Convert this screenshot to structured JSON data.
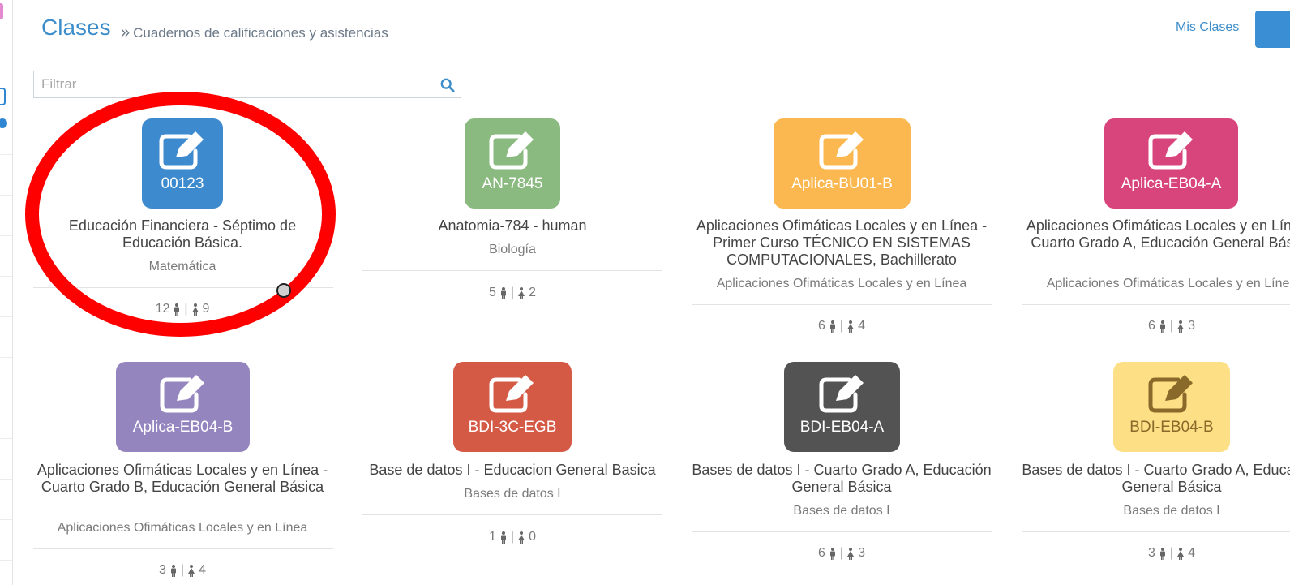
{
  "header": {
    "title": "Clases",
    "subtitle": "Cuadernos de calificaciones y asistencias",
    "separator": "»",
    "my_classes_link": "Mis Clases"
  },
  "filter": {
    "placeholder": "Filtrar"
  },
  "colors": {
    "accent": "#3c8dc9",
    "annotation": "#fe0000"
  },
  "classes": [
    {
      "code": "00123",
      "name": "Educación Financiera - Séptimo de Educación Básica.",
      "subject": "Matemática",
      "male": "12",
      "female": "9",
      "color": "#3e8ace"
    },
    {
      "code": "AN-7845",
      "name": "Anatomia-784 - human",
      "subject": "Biología",
      "male": "5",
      "female": "2",
      "color": "#8aba7f"
    },
    {
      "code": "Aplica-BU01-B",
      "name": "Aplicaciones Ofimáticas Locales y en Línea - Primer Curso TÉCNICO EN SISTEMAS COMPUTACIONALES, Bachillerato",
      "subject": "Aplicaciones Ofimáticas Locales y en Línea",
      "male": "6",
      "female": "4",
      "color": "#fbb851"
    },
    {
      "code": "Aplica-EB04-A",
      "name": "Aplicaciones Ofimáticas Locales y en Línea - Cuarto Grado A, Educación General Básica",
      "subject": "Aplicaciones Ofimáticas Locales y en Línea",
      "male": "6",
      "female": "3",
      "color": "#d8457c"
    },
    {
      "code": "Aplica-EB04-B",
      "name": "Aplicaciones Ofimáticas Locales y en Línea - Cuarto Grado B, Educación General Básica",
      "subject": "Aplicaciones Ofimáticas Locales y en Línea",
      "male": "3",
      "female": "4",
      "color": "#9485bf"
    },
    {
      "code": "BDI-3C-EGB",
      "name": "Base de datos I - Educacion General Basica",
      "subject": "Bases de datos I",
      "male": "1",
      "female": "0",
      "color": "#d45a46"
    },
    {
      "code": "BDI-EB04-A",
      "name": "Bases de datos I - Cuarto Grado A, Educación General Básica",
      "subject": "Bases de datos I",
      "male": "6",
      "female": "3",
      "color": "#535353"
    },
    {
      "code": "BDI-EB04-B",
      "name": "Bases de datos I - Cuarto Grado A, Educación General Básica",
      "subject": "Bases de datos I",
      "male": "3",
      "female": "4",
      "color": "#fde086"
    }
  ]
}
